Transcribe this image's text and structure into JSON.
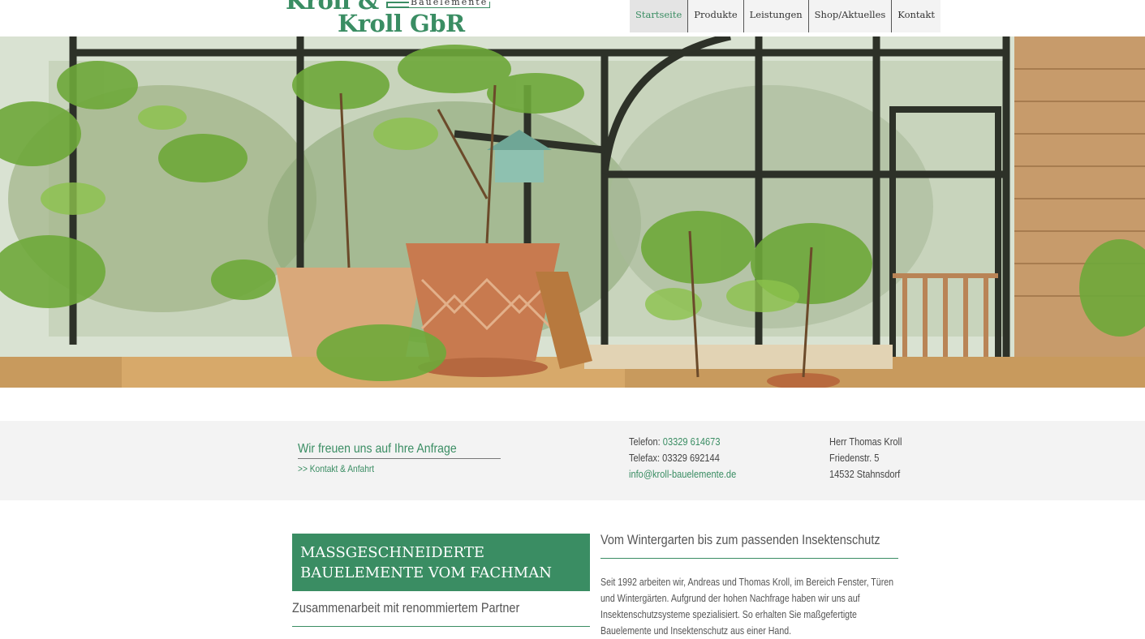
{
  "logo": {
    "line1": "Kroll &",
    "line2": "Kroll GbR",
    "tagline": "Bauelemente"
  },
  "nav": {
    "items": [
      {
        "label": "Startseite",
        "active": true
      },
      {
        "label": "Produkte"
      },
      {
        "label": "Leistungen"
      },
      {
        "label": "Shop/Aktuelles"
      },
      {
        "label": "Kontakt"
      }
    ]
  },
  "contact_band": {
    "tagline": "Wir freuen uns auf Ihre Anfrage",
    "link": ">> Kontakt & Anfahrt",
    "phone_label": "Telefon:",
    "phone": "03329 614673",
    "fax_label": "Telefax:",
    "fax": "03329 692144",
    "email": "info@kroll-bauelemente.de",
    "name": "Herr Thomas Kroll",
    "street": "Friedenstr. 5",
    "city": "14532 Stahnsdorf"
  },
  "content": {
    "box_line1": "MASSGESCHNEIDERTE",
    "box_line2": "BAUELEMENTE VOM FACHMAN",
    "left_subheading": "Zusammenarbeit mit renommiertem Partner",
    "right_heading": "Vom Wintergarten bis zum passenden Insektenschutz",
    "paragraph": "Seit 1992 arbeiten wir, Andreas und Thomas Kroll, im Bereich Fenster, Türen und Wintergärten. Aufgrund der hohen Nachfrage haben wir uns auf Insektenschutzsysteme spezialisiert. So erhalten Sie maßgefertigte Bauelemente und Insektenschutz aus einer Hand."
  },
  "colors": {
    "brand_green": "#3a8d63",
    "band_bg": "#f3f3f3"
  }
}
